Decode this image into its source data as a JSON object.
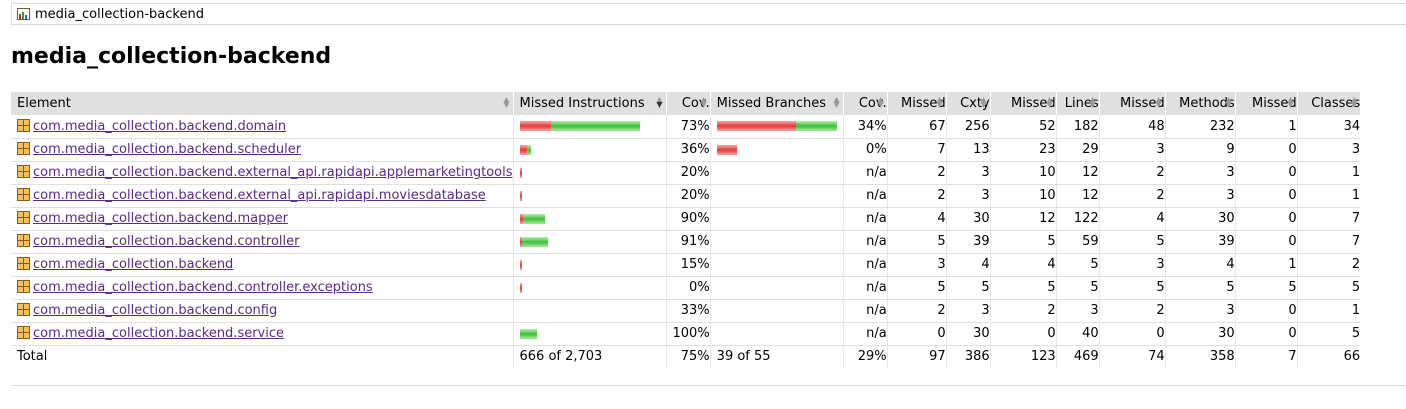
{
  "breadcrumb": {
    "label": "media_collection-backend"
  },
  "page_title": "media_collection-backend",
  "headers": [
    "Element",
    "Missed Instructions",
    "Cov.",
    "Missed Branches",
    "Cov.",
    "Missed",
    "Cxty",
    "Missed",
    "Lines",
    "Missed",
    "Methods",
    "Missed",
    "Classes"
  ],
  "rows": [
    {
      "name": "com.media_collection.backend.domain",
      "instr_missed_pct": 26,
      "cov": "73%",
      "br_missed_pct": 66,
      "br_cov": "34%",
      "has_branch": true,
      "c": [
        "67",
        "256",
        "52",
        "182",
        "48",
        "232",
        "1",
        "34"
      ]
    },
    {
      "name": "com.media_collection.backend.scheduler",
      "instr_missed_pct": 64,
      "cov": "36%",
      "br_missed_pct": 100,
      "br_cov": "0%",
      "has_branch": true,
      "c": [
        "7",
        "13",
        "23",
        "29",
        "3",
        "9",
        "0",
        "3"
      ]
    },
    {
      "name": "com.media_collection.backend.external_api.rapidapi.applemarketingtools",
      "instr_missed_pct": 80,
      "cov": "20%",
      "br_missed_pct": 0,
      "br_cov": "n/a",
      "has_branch": false,
      "c": [
        "2",
        "3",
        "10",
        "12",
        "2",
        "3",
        "0",
        "1"
      ]
    },
    {
      "name": "com.media_collection.backend.external_api.rapidapi.moviesdatabase",
      "instr_missed_pct": 80,
      "cov": "20%",
      "br_missed_pct": 0,
      "br_cov": "n/a",
      "has_branch": false,
      "c": [
        "2",
        "3",
        "10",
        "12",
        "2",
        "3",
        "0",
        "1"
      ]
    },
    {
      "name": "com.media_collection.backend.mapper",
      "instr_missed_pct": 10,
      "cov": "90%",
      "br_missed_pct": 0,
      "br_cov": "n/a",
      "has_branch": false,
      "c": [
        "4",
        "30",
        "12",
        "122",
        "4",
        "30",
        "0",
        "7"
      ]
    },
    {
      "name": "com.media_collection.backend.controller",
      "instr_missed_pct": 9,
      "cov": "91%",
      "br_missed_pct": 0,
      "br_cov": "n/a",
      "has_branch": false,
      "c": [
        "5",
        "39",
        "5",
        "59",
        "5",
        "39",
        "0",
        "7"
      ]
    },
    {
      "name": "com.media_collection.backend",
      "instr_missed_pct": 85,
      "cov": "15%",
      "br_missed_pct": 0,
      "br_cov": "n/a",
      "has_branch": false,
      "c": [
        "3",
        "4",
        "4",
        "5",
        "3",
        "4",
        "1",
        "2"
      ]
    },
    {
      "name": "com.media_collection.backend.controller.exceptions",
      "instr_missed_pct": 100,
      "cov": "0%",
      "br_missed_pct": 0,
      "br_cov": "n/a",
      "has_branch": false,
      "c": [
        "5",
        "5",
        "5",
        "5",
        "5",
        "5",
        "5",
        "5"
      ]
    },
    {
      "name": "com.media_collection.backend.config",
      "instr_missed_pct": 67,
      "cov": "33%",
      "br_missed_pct": 0,
      "br_cov": "n/a",
      "has_branch": false,
      "c": [
        "2",
        "3",
        "2",
        "3",
        "2",
        "3",
        "0",
        "1"
      ]
    },
    {
      "name": "com.media_collection.backend.service",
      "instr_missed_pct": 0,
      "cov": "100%",
      "br_missed_pct": 0,
      "br_cov": "n/a",
      "has_branch": false,
      "c": [
        "0",
        "30",
        "0",
        "40",
        "0",
        "30",
        "0",
        "5"
      ]
    }
  ],
  "total": {
    "label": "Total",
    "instr": "666 of 2,703",
    "cov": "75%",
    "br": "39 of 55",
    "br_cov": "29%",
    "c": [
      "97",
      "386",
      "123",
      "469",
      "74",
      "358",
      "7",
      "66"
    ]
  },
  "colors": {
    "missed": "#e03c3c",
    "covered": "#3cbf3c",
    "header_bg": "#e0e0e0",
    "link": "#5a2a84"
  }
}
